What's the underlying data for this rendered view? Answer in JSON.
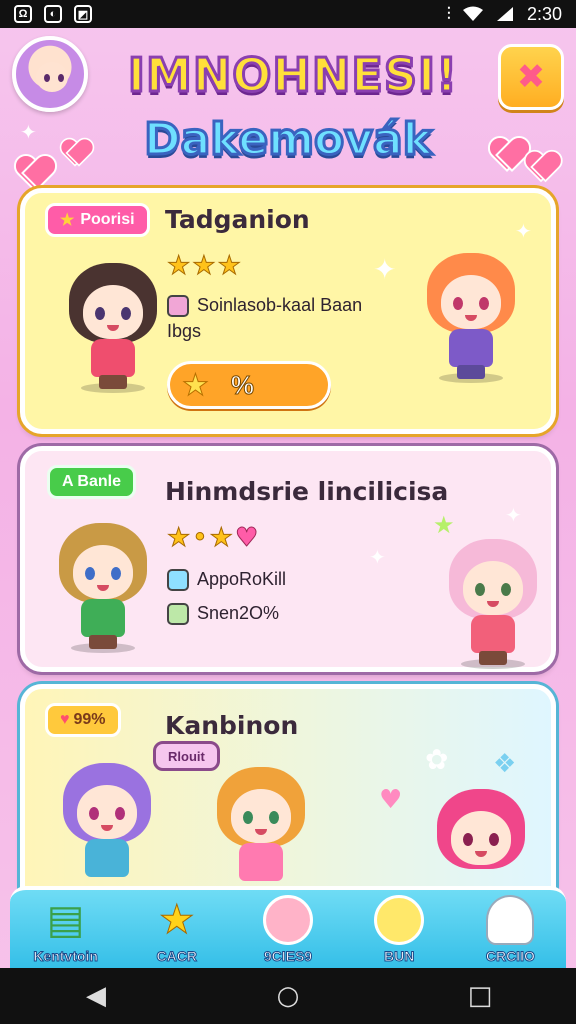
{
  "status_bar": {
    "time": "2:30",
    "left_icons": [
      "app-icon",
      "game-icon",
      "image-icon"
    ],
    "right_icons": [
      "vibrate-icon",
      "wifi-icon",
      "signal-icon"
    ]
  },
  "header": {
    "title_line1": "IMNOHNESI!",
    "title_line2": "Dakemovák",
    "close_glyph": "✖"
  },
  "cards": [
    {
      "badge": "Poorisi",
      "title": "Tadganion",
      "stars": "★★★",
      "info": [
        "Soinlasob-kaal Baan",
        "Ibgs"
      ],
      "progress_value": "%",
      "colors": {
        "badge": "#ff5ca8",
        "border": "#e6a52a"
      }
    },
    {
      "badge": "A Banle",
      "title": "Hinmdsrie lincilicisa",
      "stars": "★•★",
      "info": [
        "AppoRoKill",
        "Snen2O%"
      ],
      "colors": {
        "badge": "#48cc4a",
        "border": "#9e6aa6"
      }
    },
    {
      "badge": "99%",
      "title": "Kanbinon",
      "bubble": "Rlouit",
      "colors": {
        "badge": "#ffc93c",
        "border": "#56b5d6"
      }
    }
  ],
  "bottom_nav": [
    {
      "label": "Kentvtoin",
      "icon": "book-icon"
    },
    {
      "label": "CACR",
      "icon": "star-icon"
    },
    {
      "label": "9CIES9",
      "icon": "character-face-icon"
    },
    {
      "label": "BUN",
      "icon": "character-face-icon"
    },
    {
      "label": "CRCIIO",
      "icon": "ghost-icon"
    }
  ],
  "system_nav": {
    "back": "◀",
    "home": "○",
    "recent": "□"
  }
}
